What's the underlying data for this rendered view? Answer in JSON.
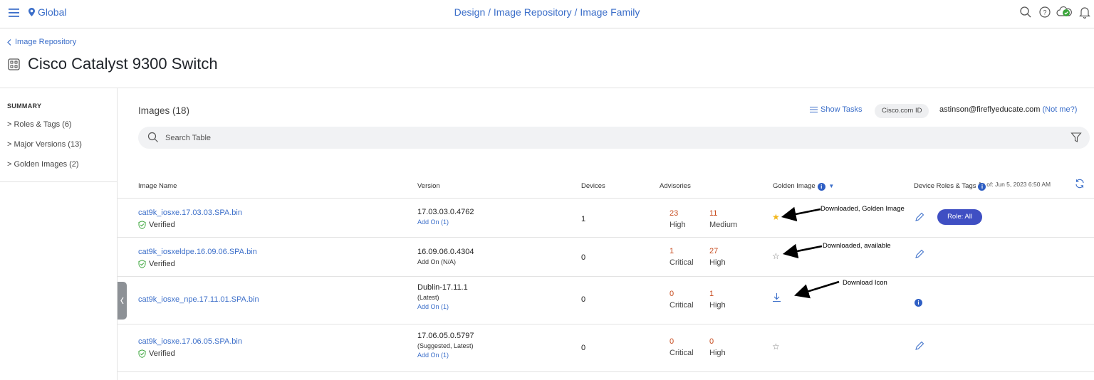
{
  "topbar": {
    "site": "Global",
    "breadcrumb": [
      "Design",
      "Image Repository",
      "Image Family"
    ],
    "separator": "/"
  },
  "header": {
    "back_link": "Image Repository",
    "title": "Cisco Catalyst 9300 Switch"
  },
  "summary": {
    "heading": "SUMMARY",
    "items": [
      {
        "label": "Roles & Tags (6)"
      },
      {
        "label": "Major Versions (13)"
      },
      {
        "label": "Golden Images (2)"
      }
    ]
  },
  "main": {
    "images_title": "Images (18)",
    "show_tasks": "Show Tasks",
    "cisco_id_label": "Cisco.com ID",
    "user_email": "astinson@fireflyeducate.com",
    "not_me": "(Not me?)",
    "search_placeholder": "Search Table",
    "as_of": "As of: Jun 5, 2023 6:50 AM"
  },
  "table": {
    "columns": [
      "Image Name",
      "Version",
      "Devices",
      "Advisories",
      "Golden Image",
      "Device Roles & Tags"
    ],
    "rows": [
      {
        "name": "cat9k_iosxe.17.03.03.SPA.bin",
        "status": "Verified",
        "version": "17.03.03.0.4762",
        "version_sub": "",
        "addon": "Add On (1)",
        "devices": "1",
        "adv1_value": "23",
        "adv1_label": "High",
        "adv2_value": "11",
        "adv2_label": "Medium",
        "golden": "golden",
        "role": "Role: All"
      },
      {
        "name": "cat9k_iosxeldpe.16.09.06.SPA.bin",
        "status": "Verified",
        "version": "16.09.06.0.4304",
        "version_sub": "Add On (N/A)",
        "addon": "",
        "devices": "0",
        "adv1_value": "1",
        "adv1_label": "Critical",
        "adv2_value": "27",
        "adv2_label": "High",
        "golden": "available",
        "role": ""
      },
      {
        "name": "cat9k_iosxe_npe.17.11.01.SPA.bin",
        "status": "",
        "version": "Dublin-17.11.1",
        "version_sub": "(Latest)",
        "addon": "Add On (1)",
        "devices": "0",
        "adv1_value": "0",
        "adv1_label": "Critical",
        "adv2_value": "1",
        "adv2_label": "High",
        "golden": "download",
        "role": ""
      },
      {
        "name": "cat9k_iosxe.17.06.05.SPA.bin",
        "status": "Verified",
        "version": "17.06.05.0.5797",
        "version_sub": "(Suggested, Latest)",
        "addon": "Add On (1)",
        "devices": "0",
        "adv1_value": "0",
        "adv1_label": "Critical",
        "adv2_value": "0",
        "adv2_label": "High",
        "golden": "available",
        "role": ""
      }
    ]
  },
  "annotations": {
    "golden": "Downloaded, Golden Image",
    "available": "Downloaded, available",
    "download": "Download Icon"
  },
  "icons": {
    "menu": "hamburger-menu-icon",
    "location": "location-pin-icon",
    "search": "search-icon",
    "help": "help-icon",
    "cloud": "cloud-status-icon",
    "bell": "bell-icon",
    "filter": "filter-icon",
    "refresh": "refresh-icon",
    "pencil": "pencil-icon",
    "star": "star-icon",
    "download": "download-icon",
    "info": "info-icon"
  },
  "colors": {
    "link": "#3b6ec9",
    "advisory": "#c74b1e",
    "golden_star": "#f2b71b",
    "role_button": "#3f4fc3",
    "info": "#2f5fc4",
    "cloud_ok": "#3aa53a"
  }
}
